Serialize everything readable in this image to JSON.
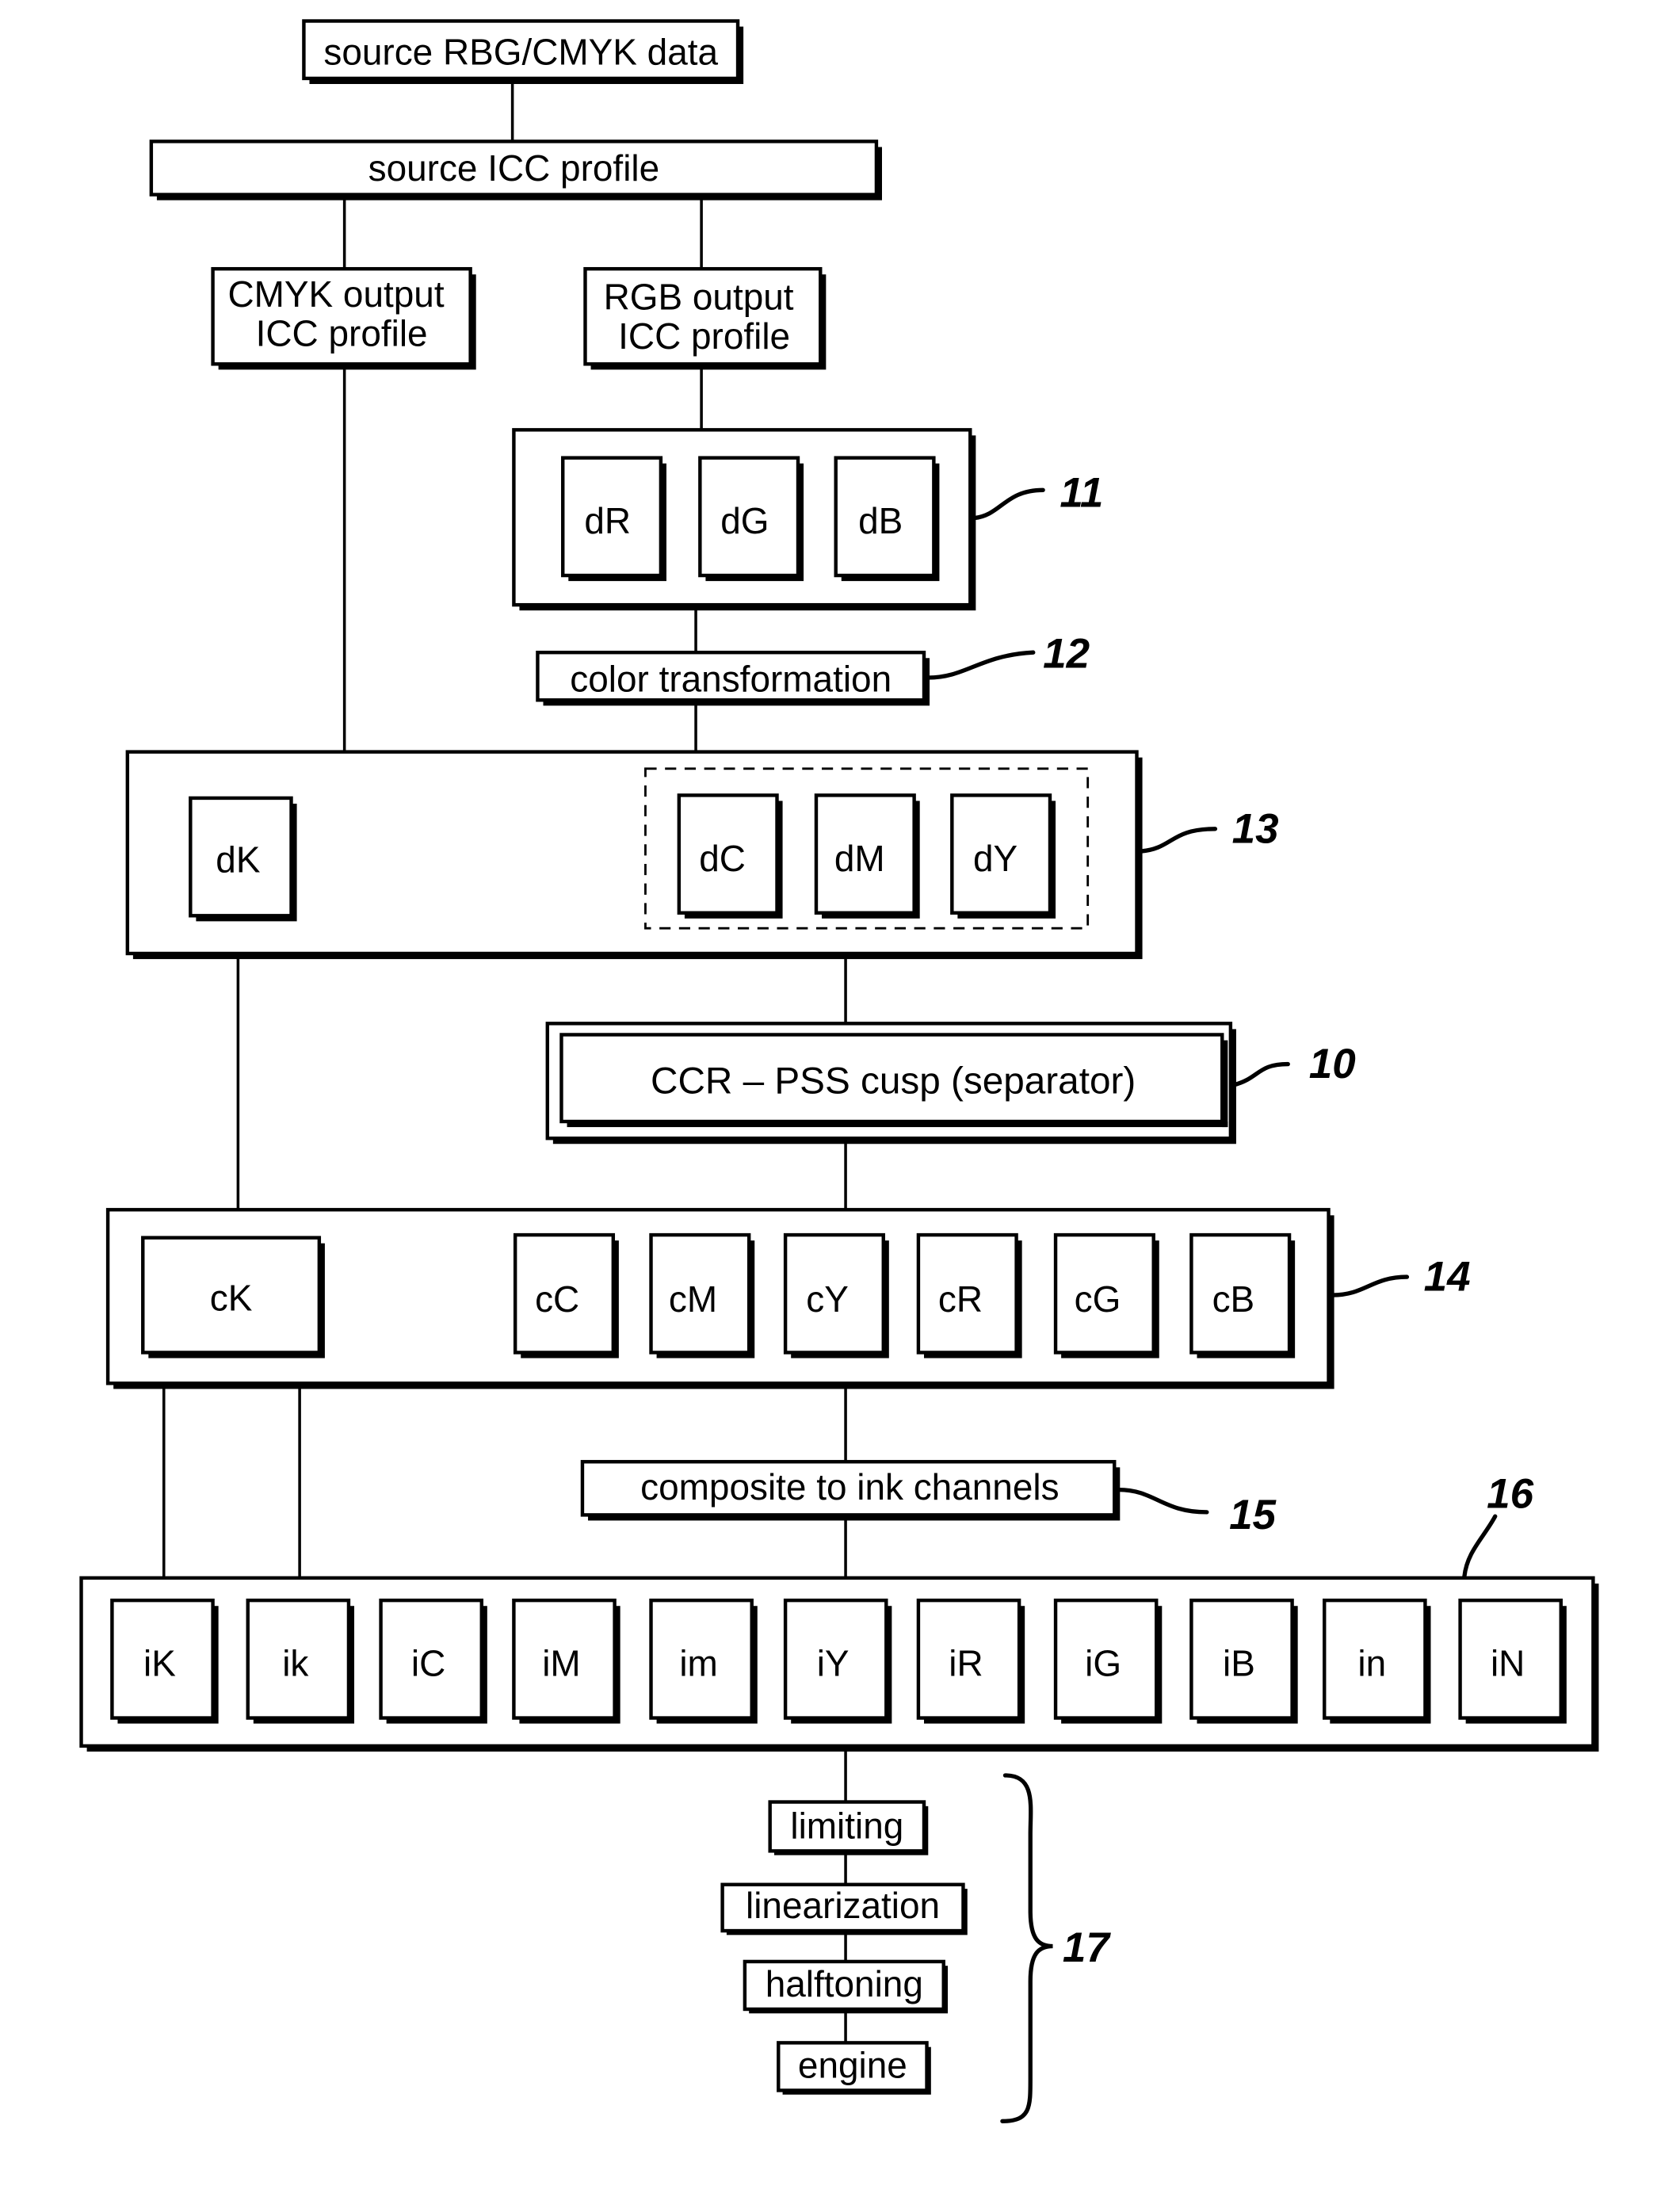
{
  "diagram": {
    "source_data": "source RBG/CMYK data",
    "source_profile": "source ICC profile",
    "cmyk_output_profile": [
      "CMYK output",
      "ICC profile"
    ],
    "rgb_output_profile": [
      "RGB output",
      "ICC profile"
    ],
    "device_rgb": [
      "dR",
      "dG",
      "dB"
    ],
    "color_transformation": "color transformation",
    "device_k": "dK",
    "device_cmy": [
      "dC",
      "dM",
      "dY"
    ],
    "separator": "CCR – PSS cusp (separator)",
    "colorant_k": "cK",
    "colorants": [
      "cC",
      "cM",
      "cY",
      "cR",
      "cG",
      "cB"
    ],
    "composite": "composite to ink channels",
    "ink_channels": [
      "iK",
      "ik",
      "iC",
      "iM",
      "im",
      "iY",
      "iR",
      "iG",
      "iB",
      "in",
      "iN"
    ],
    "pipeline": [
      "limiting",
      "linearization",
      "halftoning",
      "engine"
    ],
    "refs": {
      "r11": "11",
      "r12": "12",
      "r13": "13",
      "r10": "10",
      "r14": "14",
      "r15": "15",
      "r16": "16",
      "r17": "17"
    }
  }
}
